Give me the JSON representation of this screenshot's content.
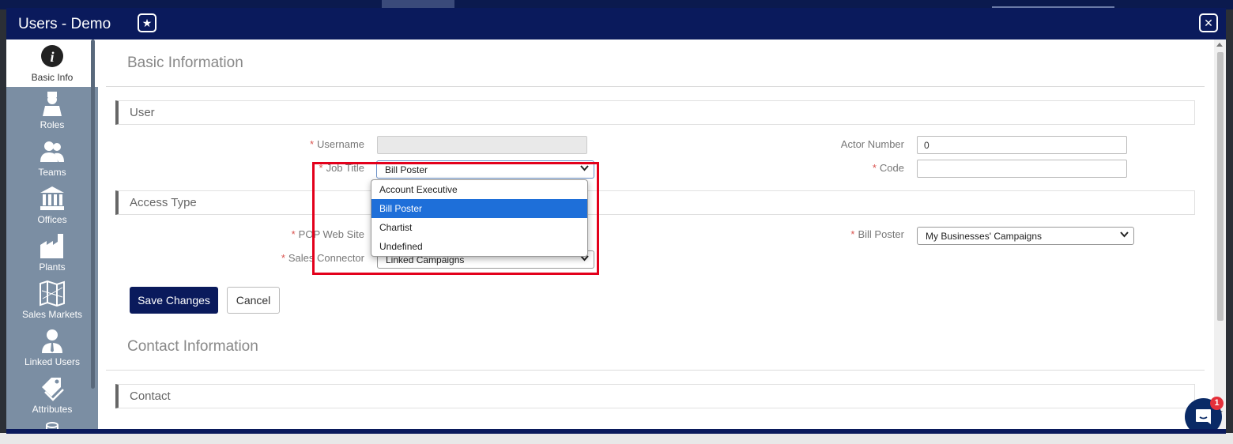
{
  "window": {
    "title": "Users - Demo",
    "star_icon": "star-icon",
    "close_icon": "close-icon"
  },
  "sidebar": {
    "items": [
      {
        "label": "Basic Info",
        "icon": "info-icon",
        "active": true
      },
      {
        "label": "Roles",
        "icon": "role-icon",
        "active": false
      },
      {
        "label": "Teams",
        "icon": "team-icon",
        "active": false
      },
      {
        "label": "Offices",
        "icon": "office-building-icon",
        "active": false
      },
      {
        "label": "Plants",
        "icon": "factory-icon",
        "active": false
      },
      {
        "label": "Sales Markets",
        "icon": "map-icon",
        "active": false
      },
      {
        "label": "Linked Users",
        "icon": "linked-user-icon",
        "active": false
      },
      {
        "label": "Attributes",
        "icon": "tags-icon",
        "active": false
      }
    ]
  },
  "basic_info": {
    "heading": "Basic Information",
    "user_group": {
      "title": "User",
      "username": {
        "label": "Username",
        "value": "",
        "required": true
      },
      "job_title": {
        "label": "Job Title",
        "value": "Bill Poster",
        "required": true
      },
      "actor_number": {
        "label": "Actor Number",
        "value": "0"
      },
      "code": {
        "label": "Code",
        "value": "",
        "required": true
      }
    },
    "access_group": {
      "title": "Access Type",
      "pop_web_site": {
        "label": "POP Web Site",
        "required": true
      },
      "sales_connector": {
        "label": "Sales Connector",
        "value": "Linked Campaigns",
        "required": true
      },
      "bill_poster": {
        "label": "Bill Poster",
        "value": "My Businesses' Campaigns",
        "required": true
      }
    },
    "save_button": "Save Changes",
    "cancel_button": "Cancel"
  },
  "contact_info": {
    "heading": "Contact Information",
    "group_title": "Contact"
  },
  "job_title_dropdown": {
    "options": [
      "Account Executive",
      "Bill Poster",
      "Chartist",
      "Undefined"
    ],
    "selected": "Bill Poster"
  },
  "chat": {
    "badge": "1"
  },
  "colors": {
    "brand_navy": "#0a1a5c",
    "sidebar": "#7b8ea3",
    "required": "#d9534f",
    "highlight": "#e3001b",
    "selected_option": "#1e6fd9"
  }
}
